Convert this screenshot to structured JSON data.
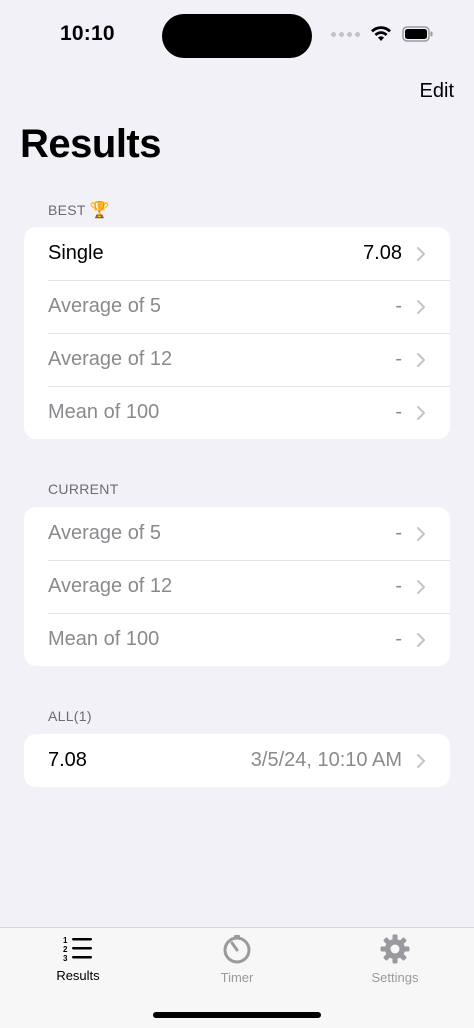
{
  "status": {
    "time": "10:10"
  },
  "nav": {
    "edit_label": "Edit",
    "title": "Results"
  },
  "best": {
    "header": "BEST",
    "header_icon": "trophy-icon",
    "header_emoji": "🏆",
    "rows": [
      {
        "label": "Single",
        "value": "7.08"
      },
      {
        "label": "Average of 5",
        "value": "-"
      },
      {
        "label": "Average of 12",
        "value": "-"
      },
      {
        "label": "Mean of 100",
        "value": "-"
      }
    ]
  },
  "current": {
    "header": "CURRENT",
    "rows": [
      {
        "label": "Average of 5",
        "value": "-"
      },
      {
        "label": "Average of 12",
        "value": "-"
      },
      {
        "label": "Mean of 100",
        "value": "-"
      }
    ]
  },
  "all": {
    "header": "ALL(1)",
    "rows": [
      {
        "label": "7.08",
        "value": "3/5/24, 10:10 AM"
      }
    ]
  },
  "tabs": [
    {
      "label": "Results",
      "icon": "numbered-list-icon",
      "selected": true
    },
    {
      "label": "Timer",
      "icon": "stopwatch-icon",
      "selected": false
    },
    {
      "label": "Settings",
      "icon": "gear-icon",
      "selected": false
    }
  ],
  "colors": {
    "background": "#f2f1f7",
    "dim_text": "#8a8a8e",
    "section_header": "#6c6c70"
  }
}
